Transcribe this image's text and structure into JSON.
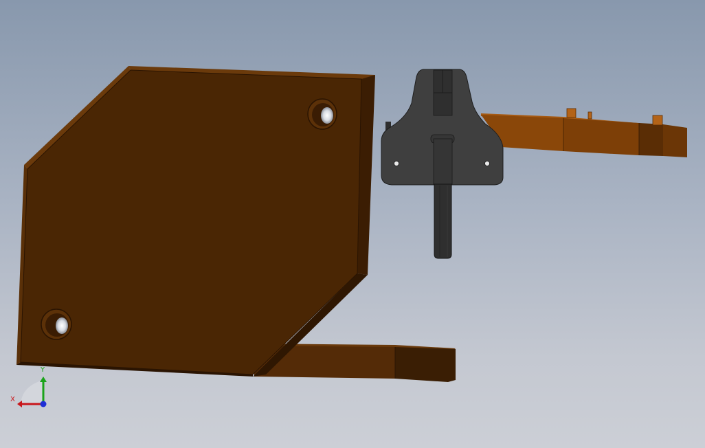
{
  "viewport": {
    "background_top": "#8898ad",
    "background_bottom": "#cccfd6"
  },
  "model": {
    "components": [
      {
        "name": "base-plate",
        "color": "#4a2604"
      },
      {
        "name": "bottom-bar",
        "color": "#5a2f08"
      },
      {
        "name": "clamp-body",
        "color": "#3f3f3f"
      },
      {
        "name": "right-arm",
        "color": "#8a4709"
      }
    ]
  },
  "triad": {
    "x_label": "X",
    "y_label": "Y",
    "x_color": "#c8161b",
    "y_color": "#1aa31a",
    "z_color": "#1e2fd6"
  }
}
